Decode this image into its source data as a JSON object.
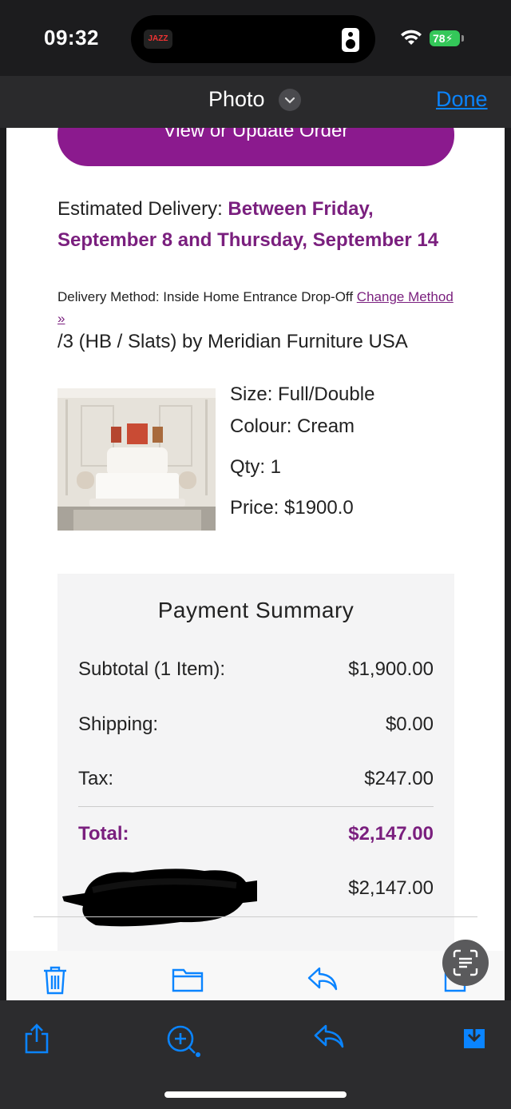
{
  "status_bar": {
    "time": "09:32",
    "island_app": "JAZZ",
    "battery": "78"
  },
  "nav": {
    "title": "Photo",
    "done": "Done"
  },
  "email": {
    "order_button": "View or Update Order",
    "estimated_label": "Estimated Delivery: ",
    "estimated_value": "Between Friday, September 8 and Thursday, September 14",
    "method_label": "Delivery Method: Inside Home Entrance Drop-Off ",
    "method_link": "Change Method »",
    "product_name": "/3 (HB / Slats) by Meridian Furniture USA",
    "attributes": {
      "size": "Size: Full/Double",
      "colour": "Colour: Cream",
      "qty": "Qty: 1",
      "price": "Price: $1900.0"
    }
  },
  "summary": {
    "title": "Payment Summary",
    "rows": [
      {
        "label": "Subtotal (1 Item):",
        "value": "$1,900.00"
      },
      {
        "label": "Shipping:",
        "value": "$0.00"
      },
      {
        "label": "Tax:",
        "value": "$247.00"
      }
    ],
    "total_label": "Total:",
    "total_value": "$2,147.00",
    "paid_value": "$2,147.00"
  },
  "colors": {
    "brand_purple": "#8b1a8e",
    "ios_blue": "#0a84ff"
  },
  "icons": {
    "mail_toolbar": [
      "trash-icon",
      "folder-icon",
      "reply-icon",
      "compose-icon"
    ],
    "bottom_toolbar": [
      "share-icon",
      "markup-icon",
      "reply-icon",
      "save-icon"
    ],
    "overlay": "live-text-icon"
  }
}
